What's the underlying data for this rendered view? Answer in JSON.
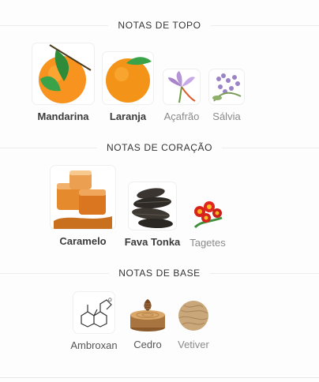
{
  "sections": [
    {
      "title": "NOTAS DE TOPO",
      "notes": [
        {
          "name": "Mandarina",
          "icon": "mandarin-icon"
        },
        {
          "name": "Laranja",
          "icon": "orange-icon"
        },
        {
          "name": "Açafrão",
          "icon": "saffron-flower-icon"
        },
        {
          "name": "Sálvia",
          "icon": "sage-flower-icon"
        }
      ]
    },
    {
      "title": "NOTAS DE CORAÇÃO",
      "notes": [
        {
          "name": "Caramelo",
          "icon": "caramel-icon"
        },
        {
          "name": "Fava Tonka",
          "icon": "tonka-bean-icon"
        },
        {
          "name": "Tagetes",
          "icon": "tagetes-flower-icon"
        }
      ]
    },
    {
      "title": "NOTAS DE BASE",
      "notes": [
        {
          "name": "Ambroxan",
          "icon": "ambroxan-molecule-icon"
        },
        {
          "name": "Cedro",
          "icon": "cedar-wood-icon"
        },
        {
          "name": "Vetiver",
          "icon": "vetiver-root-icon"
        }
      ]
    }
  ]
}
